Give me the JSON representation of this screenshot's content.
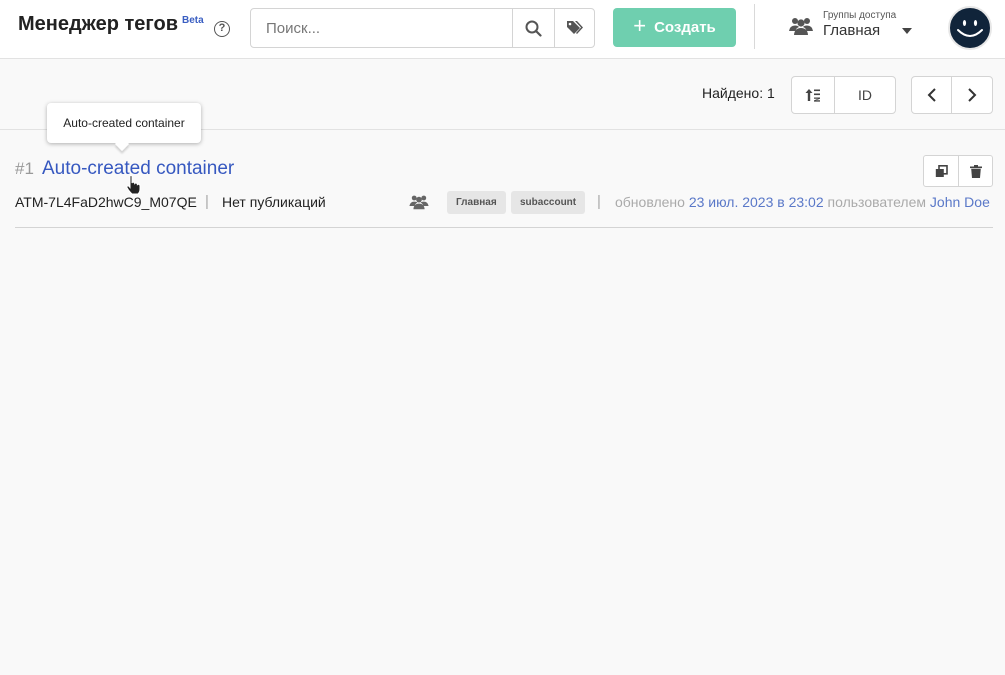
{
  "header": {
    "title": "Менеджер тегов",
    "beta": "Beta",
    "help_icon": "question-circle-icon",
    "search": {
      "placeholder": "Поиск...",
      "value": ""
    },
    "create_label": "Создать",
    "access_groups": {
      "label": "Группы доступа",
      "value": "Главная"
    }
  },
  "toolbar": {
    "found": "Найдено: 1",
    "sort_field": "ID"
  },
  "rows": [
    {
      "num": "#1",
      "title": "Auto-created container",
      "id": "ATM-7L4FaD2hwC9_M07QE",
      "pipe": "|",
      "publication": "Нет публикаций",
      "badges": [
        "Главная",
        "subaccount"
      ],
      "updated_prefix": "обновлено",
      "updated_date": "23 июл. 2023 в 23:02",
      "updated_by_prefix": "пользователем",
      "updated_user": "John Doe"
    }
  ],
  "tooltip": "Auto-created container",
  "colors": {
    "accent": "#6fcfaf",
    "link": "#3658c0",
    "avatar": "#10243a"
  }
}
